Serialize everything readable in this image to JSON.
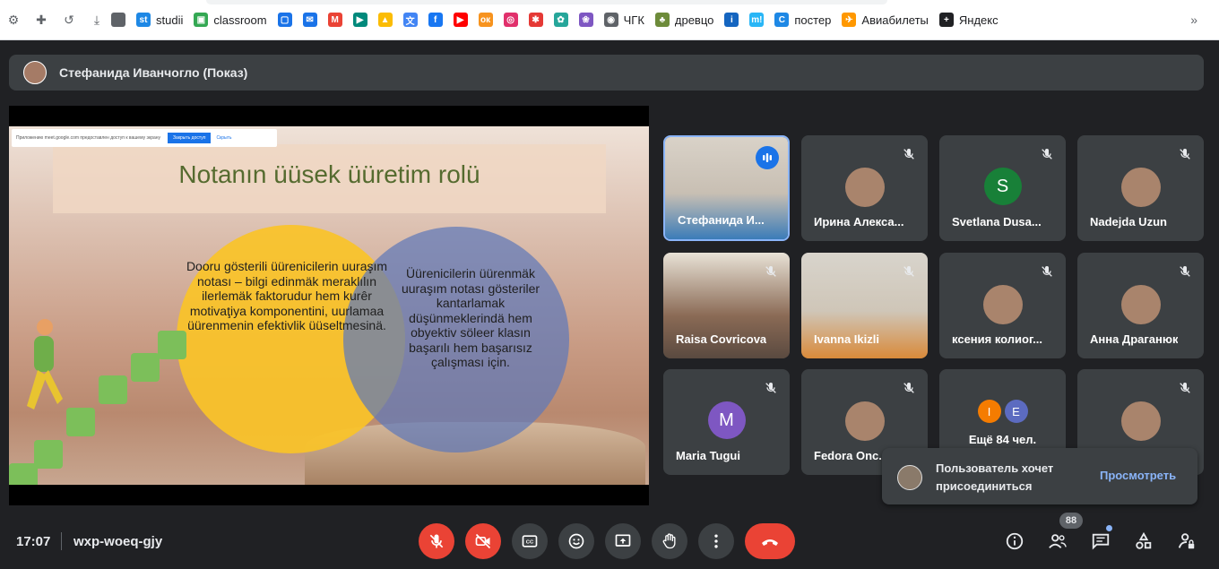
{
  "bookmarks": {
    "items": [
      {
        "label": "",
        "icon": "slack-puzzle-icon",
        "color": "#5f6368"
      },
      {
        "label": "studii",
        "icon": "studii-icon",
        "color": "#1e88e5",
        "glyph": "st"
      },
      {
        "label": "classroom",
        "icon": "classroom-icon",
        "color": "#34a853",
        "glyph": "▣"
      },
      {
        "label": "",
        "icon": "chat-icon",
        "color": "#1a73e8",
        "glyph": "▢"
      },
      {
        "label": "",
        "icon": "outlook-icon",
        "color": "#1a73e8",
        "glyph": "✉"
      },
      {
        "label": "",
        "icon": "gmail-icon",
        "color": "#ea4335",
        "glyph": "M"
      },
      {
        "label": "",
        "icon": "meet-icon",
        "color": "#00897b",
        "glyph": "▶"
      },
      {
        "label": "",
        "icon": "drive-icon",
        "color": "#fbbc04",
        "glyph": "▲"
      },
      {
        "label": "",
        "icon": "translate-icon",
        "color": "#4285f4",
        "glyph": "文"
      },
      {
        "label": "",
        "icon": "facebook-icon",
        "color": "#1877f2",
        "glyph": "f"
      },
      {
        "label": "",
        "icon": "youtube-icon",
        "color": "#ff0000",
        "glyph": "▶"
      },
      {
        "label": "",
        "icon": "odnoklassniki-icon",
        "color": "#f7931e",
        "glyph": "ок"
      },
      {
        "label": "",
        "icon": "instagram-icon",
        "color": "#e1306c",
        "glyph": "◎"
      },
      {
        "label": "",
        "icon": "star-app-icon",
        "color": "#e53935",
        "glyph": "✱"
      },
      {
        "label": "",
        "icon": "green-circle-icon",
        "color": "#26a69a",
        "glyph": "✿"
      },
      {
        "label": "",
        "icon": "lotus-icon",
        "color": "#7e57c2",
        "glyph": "❀"
      },
      {
        "label": "ЧГК",
        "icon": "globe-icon",
        "color": "#5f6368",
        "glyph": "◉"
      },
      {
        "label": "древцо",
        "icon": "tree-icon",
        "color": "#6d8b3a",
        "glyph": "♣"
      },
      {
        "label": "",
        "icon": "info-app-icon",
        "color": "#1565c0",
        "glyph": "i"
      },
      {
        "label": "",
        "icon": "m-app-icon",
        "color": "#29b6f6",
        "glyph": "m!"
      },
      {
        "label": "постер",
        "icon": "poster-icon",
        "color": "#1e88e5",
        "glyph": "C"
      },
      {
        "label": "Авиабилеты",
        "icon": "aviatickets-icon",
        "color": "#ff9800",
        "glyph": "✈"
      },
      {
        "label": "Яндекс",
        "icon": "yandex-icon",
        "color": "#202124",
        "glyph": "+"
      }
    ],
    "more_label": "»"
  },
  "presenter": {
    "name": "Стефанида Иванчогло (Показ)"
  },
  "slide": {
    "share_note": "Приложению meet.google.com предоставлен доступ к вашему экрану",
    "share_button": "Закрыть доступ",
    "share_hide": "Скрыть",
    "title": "Notanın üüsek üüretim rolü",
    "left_text": "Dooru gösterili üürenicilerin uuraşım notası – bilgi edinmäk meraklılın ilerlemäk faktorudur hem kurêr motivaţiya komponentini, uurlamaa üürenmenin efektivlik üüseltmesinä.",
    "right_text": "Üürenicilerin üürenmäk uuraşım notası gösteriler kantarlamak düşünmeklerindä hem obyektiv söleer klasın başarılı hem başarısız çalışması için."
  },
  "participants": [
    {
      "name": "Стефанида И...",
      "type": "video",
      "muted": false,
      "active": true
    },
    {
      "name": "Ирина Алекса...",
      "type": "photo",
      "muted": true
    },
    {
      "name": "Svetlana Dusa...",
      "type": "letter",
      "letter": "S",
      "color": "#188038",
      "muted": true
    },
    {
      "name": "Nadejda Uzun",
      "type": "photo",
      "muted": true
    },
    {
      "name": "Raisa Covricova",
      "type": "video",
      "muted": true
    },
    {
      "name": "Ivanna Ikizli",
      "type": "video",
      "muted": true
    },
    {
      "name": "ксения колиог...",
      "type": "photo",
      "muted": true
    },
    {
      "name": "Анна Драганюк",
      "type": "photo",
      "muted": true
    },
    {
      "name": "Maria Tugui",
      "type": "letter",
      "letter": "M",
      "color": "#7e57c2",
      "muted": true
    },
    {
      "name": "Fedora Onc...",
      "type": "photo",
      "muted": true
    },
    {
      "name": "Ещё 84 чел.",
      "type": "more",
      "letters": [
        "I",
        "E"
      ],
      "letter_colors": [
        "#f57c00",
        "#5c6bc0"
      ],
      "muted": false
    },
    {
      "name": "",
      "type": "photo",
      "muted": true
    }
  ],
  "notification": {
    "text": "Пользователь хочет присоединиться",
    "action": "Просмотреть"
  },
  "meeting": {
    "time": "17:07",
    "code": "wxp-woeq-gjy",
    "participants_count": "88"
  },
  "colors": {
    "accent": "#8ab4f8",
    "danger": "#ea4335",
    "surface": "#3c4043",
    "background": "#202124"
  }
}
